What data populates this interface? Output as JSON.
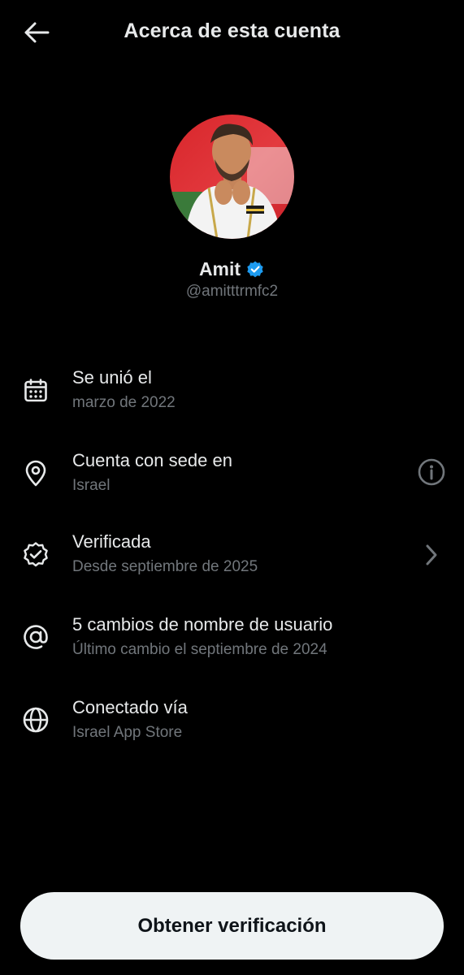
{
  "header": {
    "title": "Acerca de esta cuenta",
    "back_icon": "arrow-left-icon"
  },
  "profile": {
    "name": "Amit",
    "handle": "@amitttrmfc2",
    "verified_badge_color": "#1d9bf0",
    "avatar_icon": "profile-photo"
  },
  "info": [
    {
      "icon": "calendar-icon",
      "title": "Se unió el",
      "subtitle": "marzo de 2022"
    },
    {
      "icon": "location-pin-icon",
      "title": "Cuenta con sede en",
      "subtitle": "Israel",
      "action_icon": "info-circle-icon"
    },
    {
      "icon": "verified-badge-icon",
      "title": "Verificada",
      "subtitle": "Desde septiembre de 2025",
      "action_icon": "chevron-right-icon"
    },
    {
      "icon": "at-sign-icon",
      "title": "5 cambios de nombre de usuario",
      "subtitle": "Último cambio el septiembre de 2024"
    },
    {
      "icon": "globe-icon",
      "title": "Conectado vía",
      "subtitle": "Israel App Store"
    }
  ],
  "cta": {
    "label": "Obtener verificación"
  },
  "colors": {
    "background": "#000000",
    "primary_text": "#e7e9ea",
    "secondary_text": "#71767b",
    "button_bg": "#eff3f4",
    "button_text": "#0f1419"
  }
}
